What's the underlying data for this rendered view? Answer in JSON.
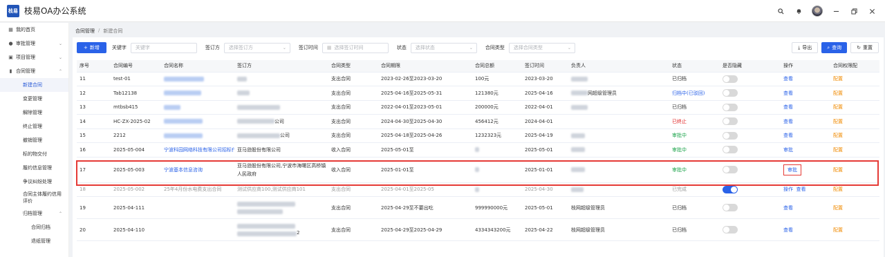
{
  "app": {
    "title": "枝易OA办公系统",
    "logo": "枝易"
  },
  "topbar": {
    "icons": [
      "search-icon",
      "bell-icon",
      "avatar",
      "minimize-icon",
      "restore-icon",
      "close-icon"
    ]
  },
  "sidebar": {
    "items": [
      {
        "label": "我的首页",
        "icon": "grid-icon"
      },
      {
        "label": "审批管理",
        "icon": "user-icon",
        "chevron": "down"
      },
      {
        "label": "项目管理",
        "icon": "folder-icon",
        "chevron": "down"
      },
      {
        "label": "合同管理",
        "icon": "chart-icon",
        "chevron": "up"
      }
    ],
    "contract_sub": [
      {
        "label": "新建合同",
        "active": true
      },
      {
        "label": "变更管理"
      },
      {
        "label": "解除管理"
      },
      {
        "label": "终止管理"
      },
      {
        "label": "撤销管理"
      },
      {
        "label": "标的物交付"
      },
      {
        "label": "履约信息管理"
      },
      {
        "label": "争议纠纷处理"
      },
      {
        "label": "合同主体履约信用评价"
      },
      {
        "label": "归档管理",
        "chevron": "up"
      }
    ],
    "archive_sub": [
      {
        "label": "合同归档"
      },
      {
        "label": "退纸管理"
      }
    ]
  },
  "breadcrumb": {
    "root": "合同管理",
    "sep": "/",
    "current": "新建合同"
  },
  "filter": {
    "new_label": "新增",
    "keyword_label": "关键字",
    "keyword_placeholder": "关键字",
    "party_label": "签订方",
    "party_placeholder": "选择签订方",
    "date_label": "签订时间",
    "date_placeholder": "选择签订时间",
    "status_label": "状态",
    "status_placeholder": "选择状态",
    "type_label": "合同类型",
    "type_placeholder": "选择合同类型"
  },
  "actions": {
    "export": "导出",
    "query": "查询",
    "reset": "重置"
  },
  "table": {
    "headers": [
      "序号",
      "合同编号",
      "合同名称",
      "签订方",
      "合同类型",
      "合同期限",
      "合同总额",
      "签订时间",
      "负责人",
      "状态",
      "是否隐藏",
      "操作",
      "合同权限配"
    ],
    "rows": [
      {
        "no": "11",
        "code": "test-01",
        "name": "",
        "party": "",
        "type": "支出合同",
        "term": "2023-02-26至2023-03-20",
        "amount": "100元",
        "date": "2023-03-20",
        "owner": "",
        "status": "已归档",
        "hidden": false,
        "ops": "查看",
        "perm": "配置"
      },
      {
        "no": "12",
        "code": "Tab12138",
        "name": "",
        "party": "",
        "type": "支出合同",
        "term": "2025-04-16至2025-05-31",
        "amount": "121380元",
        "date": "2025-04-16",
        "owner": "网超级管理员",
        "status": "归档中(已驳回)",
        "hidden": false,
        "ops": "查看",
        "perm": "配置"
      },
      {
        "no": "13",
        "code": "mtbsb415",
        "name": "",
        "party": "",
        "type": "支出合同",
        "term": "2022-04-01至2023-05-01",
        "amount": "200000元",
        "date": "2022-04-01",
        "owner": "",
        "status": "已归档",
        "hidden": false,
        "ops": "查看",
        "perm": "配置"
      },
      {
        "no": "14",
        "code": "HC-ZX-2025-02",
        "name": "",
        "party": "公司",
        "type": "支出合同",
        "term": "2024-04-30至2025-04-30",
        "amount": "456412元",
        "date": "2024-04-01",
        "owner": "",
        "status": "已终止",
        "hidden": false,
        "ops": "查看",
        "perm": "配置"
      },
      {
        "no": "15",
        "code": "2212",
        "name": "",
        "party": "公司",
        "type": "支出合同",
        "term": "2025-04-18至2025-04-26",
        "amount": "1232323元",
        "date": "2025-04-19",
        "owner": "",
        "status": "审批中",
        "hidden": false,
        "ops": "查看",
        "perm": "配置"
      },
      {
        "no": "16",
        "code": "2025-05-004",
        "name": "宁波科园网络科技有限公司招标代理",
        "party": "亚马逊股份有限公司",
        "type": "收入合同",
        "term": "2025-05-01至",
        "amount": "",
        "date": "2025-05-01",
        "owner": "",
        "status": "审批中",
        "hidden": false,
        "ops": "审批",
        "perm": "配置"
      },
      {
        "no": "17",
        "code": "2025-05-003",
        "name": "宁波基本信息咨询",
        "party": "亚马逊股份有限公司,宁波市海曙区高桥镇人民政府",
        "type": "收入合同",
        "term": "2025-01-01至",
        "amount": "",
        "date": "2025-01-01",
        "owner": "",
        "status": "审批中",
        "hidden": false,
        "ops": "审批",
        "perm": "配置"
      },
      {
        "no": "18",
        "code": "2025-05-002",
        "name": "25年4月份水电费支出合同",
        "party": "测试供应商100,测试供应商101",
        "type": "支出合同",
        "term": "2025-04-01至2025-05",
        "amount": "",
        "date": "2025-04-30",
        "owner": "",
        "status": "已完成",
        "hidden": true,
        "ops": "操作",
        "ops2": "查看",
        "perm": "配置"
      },
      {
        "no": "19",
        "code": "2025-04-111",
        "name": "",
        "party": "",
        "type": "支出合同",
        "term": "2025-04-29至不要出吃",
        "amount": "999990000元",
        "date": "2025-05-01",
        "owner": "枝网超级管理员",
        "status": "已归档",
        "hidden": false,
        "ops": "查看",
        "perm": "配置"
      },
      {
        "no": "20",
        "code": "2025-04-110",
        "name": "",
        "party": "2",
        "type": "支出合同",
        "term": "2025-04-29至2025-04-29",
        "amount": "4334343200元",
        "date": "2025-04-22",
        "owner": "枝网超级管理员",
        "status": "已归档",
        "hidden": false,
        "ops": "查看",
        "perm": "配置"
      }
    ]
  },
  "colors": {
    "primary": "#2a62e8",
    "config": "#f08a00",
    "approving": "#1aa34a",
    "terminated": "#e02020",
    "highlight": "#e53935"
  }
}
